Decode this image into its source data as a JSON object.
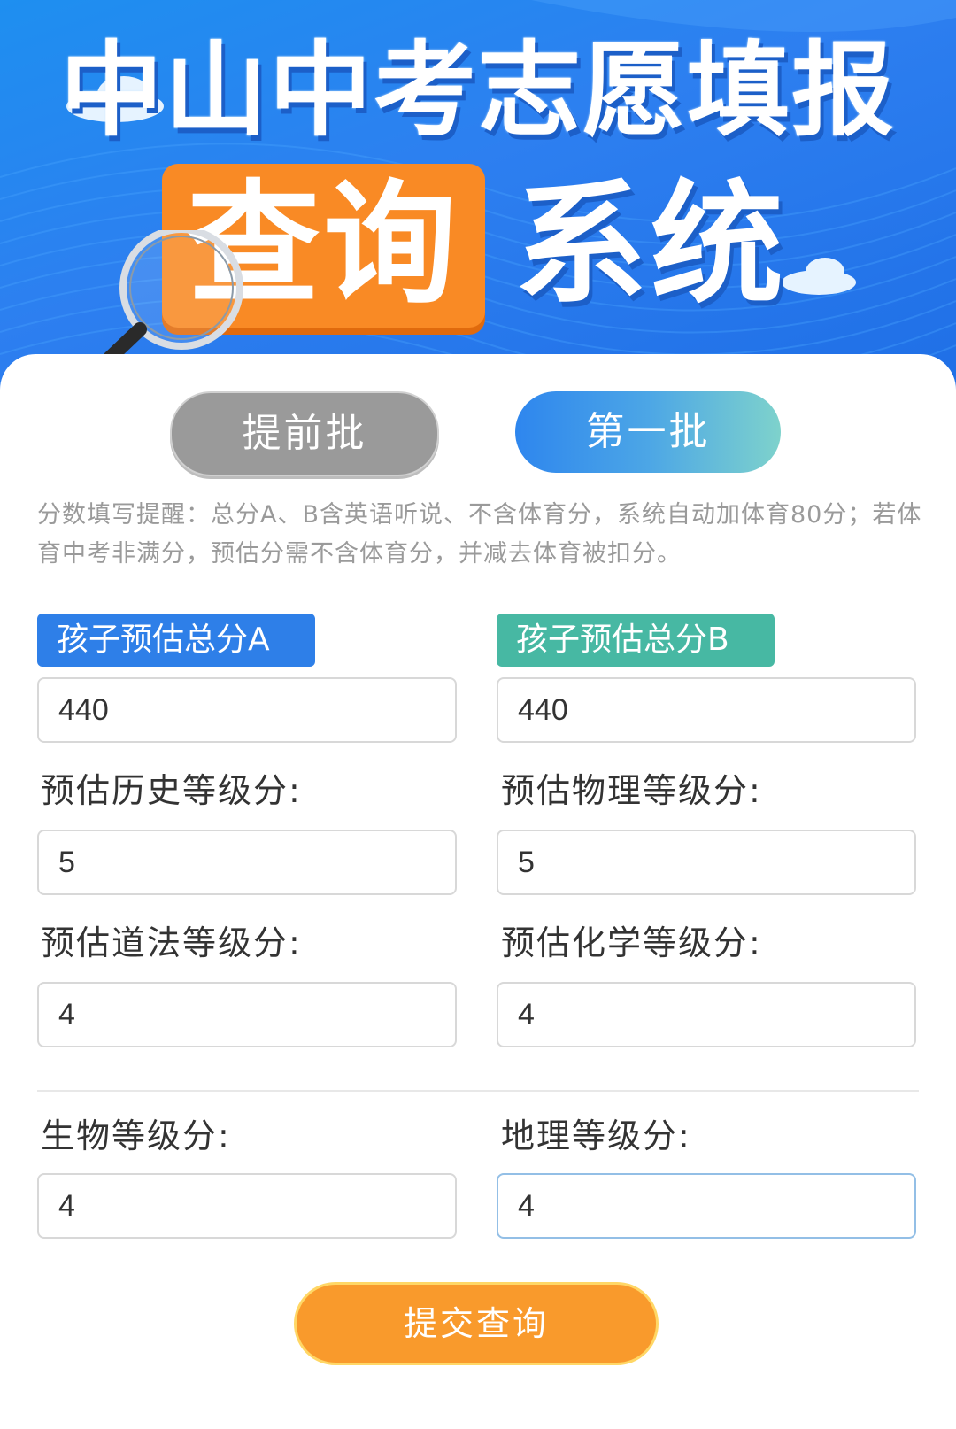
{
  "banner": {
    "title_line1": "中山中考志愿填报",
    "title_query": "查询",
    "title_system": "系统",
    "colors": {
      "banner_blue": "#2d7ff0",
      "accent_orange": "#f98a25"
    }
  },
  "tabs": {
    "early": "提前批",
    "first": "第一批",
    "selected": "第一批"
  },
  "notice": "分数填写提醒：总分A、B含英语听说、不含体育分，系统自动加体育80分；若体育中考非满分，预估分需不含体育分，并减去体育被扣分。",
  "form": {
    "total_a": {
      "label": "孩子预估总分A",
      "value": "440"
    },
    "total_b": {
      "label": "孩子预估总分B",
      "value": "440"
    },
    "history": {
      "label": "预估历史等级分:",
      "value": "5"
    },
    "physics": {
      "label": "预估物理等级分:",
      "value": "5"
    },
    "politics": {
      "label": "预估道法等级分:",
      "value": "4"
    },
    "chemistry": {
      "label": "预估化学等级分:",
      "value": "4"
    },
    "biology": {
      "label": "生物等级分:",
      "value": "4"
    },
    "geography": {
      "label": "地理等级分:",
      "value": "4"
    }
  },
  "submit_label": "提交查询"
}
